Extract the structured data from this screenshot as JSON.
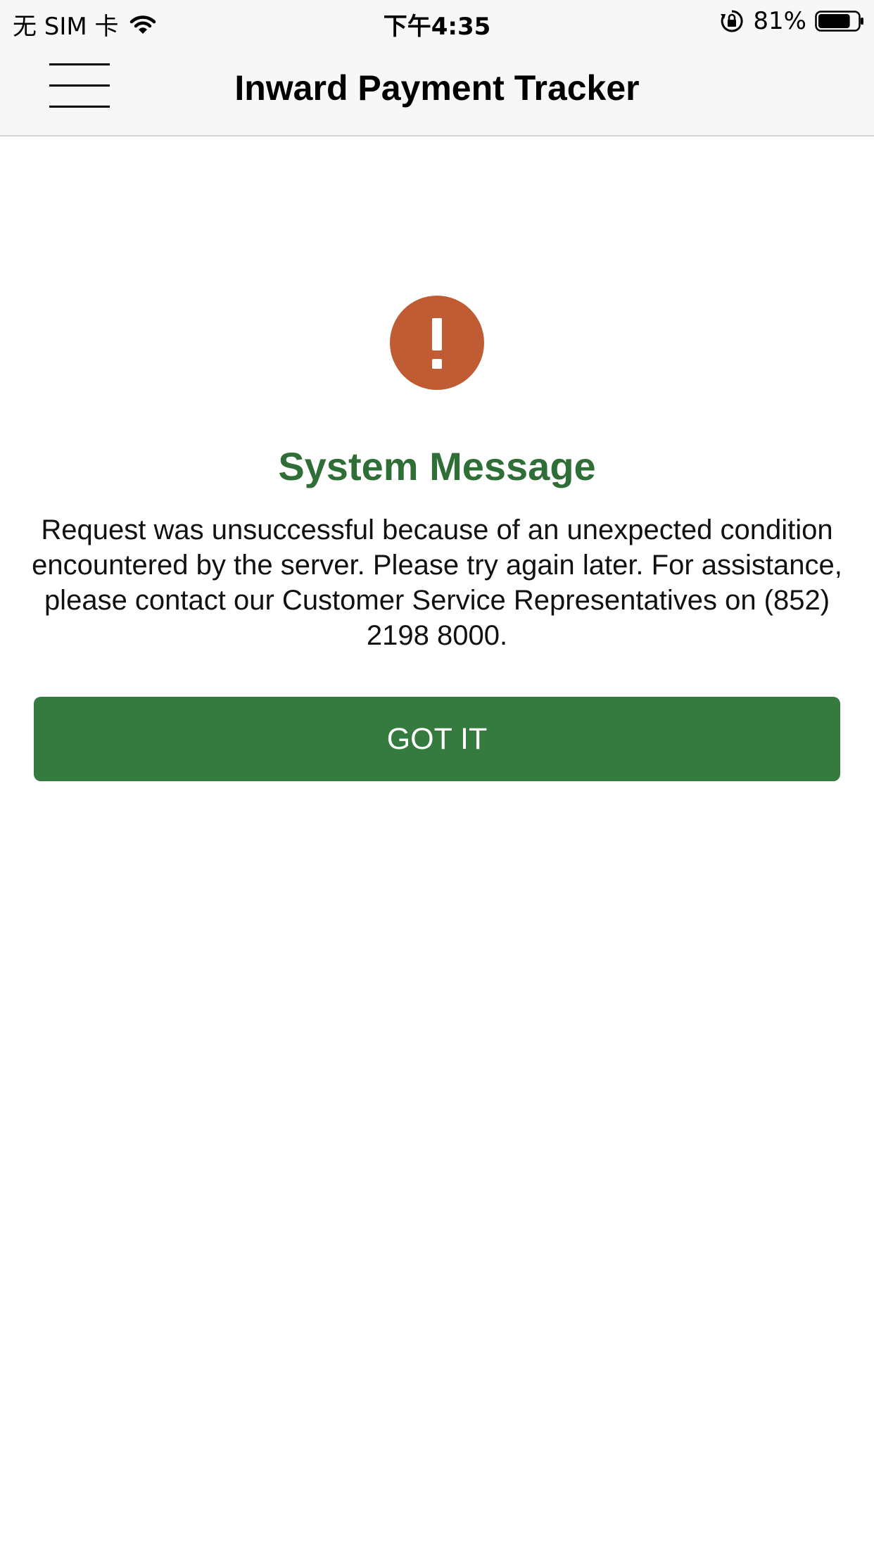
{
  "status_bar": {
    "carrier": "无 SIM 卡",
    "time": "下午4:35",
    "battery_percent": "81%",
    "battery_level": 0.81,
    "icons": [
      "wifi-icon",
      "rotation-lock-icon",
      "battery-icon"
    ]
  },
  "header": {
    "title": "Inward Payment Tracker",
    "menu_icon": "hamburger-menu-icon"
  },
  "message": {
    "icon": "exclamation-icon",
    "icon_color": "#c05c34",
    "title": "System Message",
    "title_color": "#2f6f37",
    "body": "Request was unsuccessful because of an unexpected condition encountered by the server. Please try again later. For assistance, please contact our Customer Service Representatives on (852) 2198 8000."
  },
  "actions": {
    "got_it_label": "GOT IT",
    "button_color": "#357a3f"
  }
}
